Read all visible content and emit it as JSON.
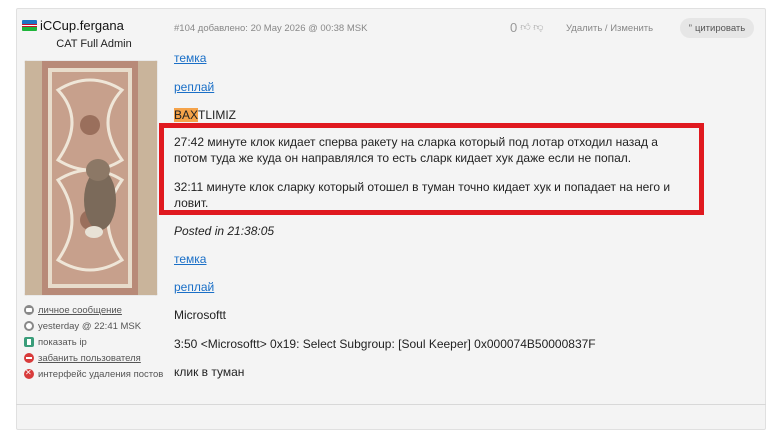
{
  "user": {
    "name": "iCCup.fergana",
    "rank": "CAT Full Admin"
  },
  "post": {
    "meta": "#104 добавлено: 20 May 2026 @ 00:38 MSK",
    "votes": "0",
    "delete_label": "Удалить",
    "separator": "/",
    "edit_label": "Изменить",
    "quote_label": "цитировать",
    "quote_icon": "”",
    "link1": "темка",
    "link2": "реплай",
    "bax_highlight": "BAX",
    "bax_rest": "TLIMIZ",
    "para1": "27:42 минуте клок кидает сперва ракету на сларка который под лотар отходил назад а потом туда же куда он направлялся то есть сларк кидает хук даже если не попал.",
    "para2": "32:11 минуте клок сларку который отошел в туман точно кидает хук и попадает на него и ловит.",
    "posted": "Posted in 21:38:05",
    "link3": "темка",
    "link4": "реплай",
    "line_ms": "Microsoftt",
    "line_log": "3:50 <Microsoftt> 0x19: Select Subgroup: [Soul Keeper] 0x000074B50000837F",
    "line_last": "клик в туман"
  },
  "actions": {
    "pm": "личное сообщение",
    "last_seen": "yesterday @ 22:41 MSK",
    "show_ip": "показать ip",
    "ban_user": "забанить пользователя",
    "delete_ui": "интерфейс удаления постов"
  }
}
